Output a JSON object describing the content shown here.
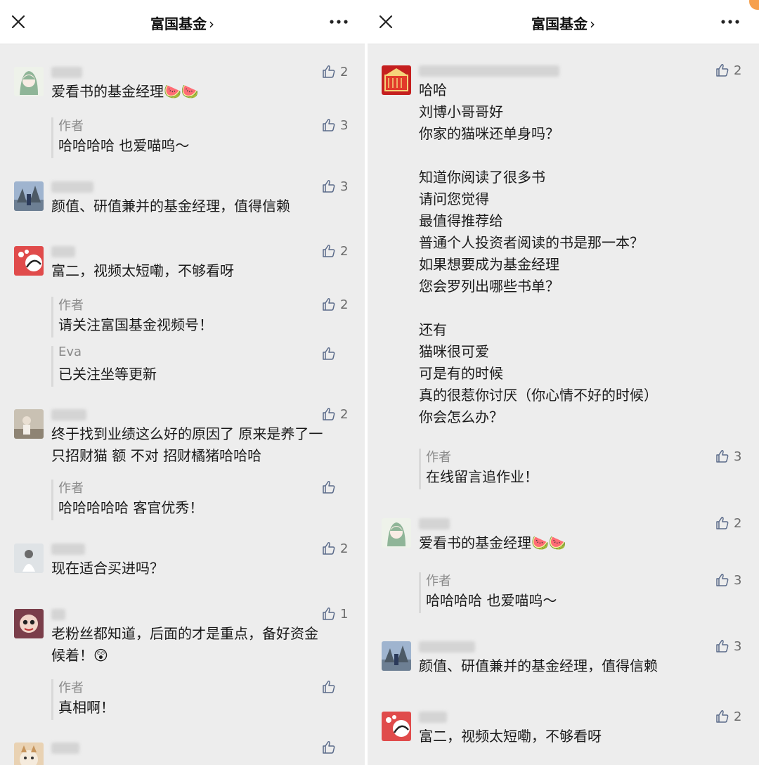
{
  "header": {
    "title": "富国基金",
    "chevron": "›",
    "close_icon": "close-icon",
    "more_icon": "more-icon"
  },
  "colors": {
    "background": "#ededed",
    "header": "#ffffff",
    "text": "#1a1a1a",
    "muted": "#8a8a8a",
    "like_icon": "#5b6b8a"
  },
  "left": {
    "comments": [
      {
        "text": "爱看书的基金经理🍉🍉",
        "likes": "2",
        "replies": [
          {
            "label": "作者",
            "text": "哈哈哈哈 也爱喵呜～",
            "likes": "3"
          }
        ]
      },
      {
        "text": "颜值、研值兼并的基金经理，值得信赖",
        "likes": "3",
        "replies": []
      },
      {
        "text": "富二，视频太短嘞，不够看呀",
        "likes": "2",
        "replies": [
          {
            "label": "作者",
            "text": "请关注富国基金视频号！",
            "likes": "2"
          },
          {
            "label": "Eva",
            "text": "已关注坐等更新",
            "likes": ""
          }
        ]
      },
      {
        "text": "终于找到业绩这么好的原因了 原来是养了一\n只招财猫 额 不对 招财橘猪哈哈哈",
        "likes": "2",
        "replies": [
          {
            "label": "作者",
            "text": "哈哈哈哈哈 客官优秀！",
            "likes": ""
          }
        ]
      },
      {
        "text": "现在适合买进吗？",
        "likes": "2",
        "replies": []
      },
      {
        "text": "老粉丝都知道，后面的才是重点，备好资金\n候着！😲",
        "likes": "1",
        "replies": [
          {
            "label": "作者",
            "text": "真相啊！",
            "likes": ""
          }
        ]
      },
      {
        "text": "",
        "likes": "",
        "replies": []
      }
    ]
  },
  "right": {
    "comments": [
      {
        "text": "哈哈\n刘博小哥哥好\n你家的猫咪还单身吗？\n\n知道你阅读了很多书\n请问您觉得\n最值得推荐给\n普通个人投资者阅读的书是那一本？\n如果想要成为基金经理\n您会罗列出哪些书单？\n\n还有\n猫咪很可爱\n可是有的时候\n真的很惹你讨厌（你心情不好的时候）\n你会怎么办？",
        "likes": "2",
        "replies": [
          {
            "label": "作者",
            "text": "在线留言追作业！",
            "likes": "3"
          }
        ]
      },
      {
        "text": "爱看书的基金经理🍉🍉",
        "likes": "2",
        "replies": [
          {
            "label": "作者",
            "text": "哈哈哈哈 也爱喵呜～",
            "likes": "3"
          }
        ]
      },
      {
        "text": "颜值、研值兼并的基金经理，值得信赖",
        "likes": "3",
        "replies": []
      },
      {
        "text": "富二，视频太短嘞，不够看呀",
        "likes": "2",
        "replies": []
      }
    ]
  }
}
